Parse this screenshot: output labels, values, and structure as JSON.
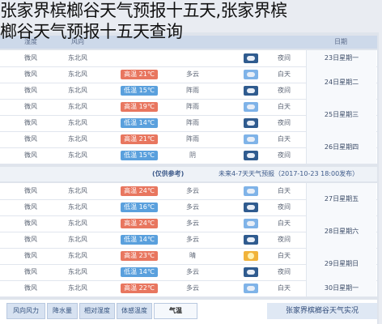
{
  "page_title": {
    "line1": "张家界槟榔谷天气预报十五天,张家界槟",
    "line2": "榔谷天气预报十五天查询"
  },
  "header": {
    "humidity": "湿度",
    "wind": "风向",
    "date": "日期"
  },
  "blocks": [
    {
      "rows": [
        {
          "hum": "微风",
          "dir": "东北风",
          "temp": "",
          "temp_type": "none",
          "weather": "",
          "icon": "night",
          "dn": "夜间",
          "date": "23日星期一",
          "date_span": 1
        },
        {
          "hum": "微风",
          "dir": "东北风",
          "temp": "高温 21℃",
          "temp_type": "hot",
          "weather": "多云",
          "icon": "day",
          "dn": "白天",
          "date": "24日星期二",
          "date_span": 2
        },
        {
          "hum": "微风",
          "dir": "东北风",
          "temp": "低温 15℃",
          "temp_type": "cool",
          "weather": "阵雨",
          "icon": "night",
          "dn": "夜间",
          "date": "",
          "date_span": 0
        },
        {
          "hum": "微风",
          "dir": "东北风",
          "temp": "高温 19℃",
          "temp_type": "hot",
          "weather": "阵雨",
          "icon": "day",
          "dn": "白天",
          "date": "25日星期三",
          "date_span": 2
        },
        {
          "hum": "微风",
          "dir": "东北风",
          "temp": "低温 14℃",
          "temp_type": "cool",
          "weather": "阵雨",
          "icon": "night",
          "dn": "夜间",
          "date": "",
          "date_span": 0
        },
        {
          "hum": "微风",
          "dir": "东北风",
          "temp": "高温 21℃",
          "temp_type": "hot",
          "weather": "阵雨",
          "icon": "day",
          "dn": "白天",
          "date": "26日星期四",
          "date_span": 2
        },
        {
          "hum": "微风",
          "dir": "东北风",
          "temp": "低温 15℃",
          "temp_type": "cool",
          "weather": "阴",
          "icon": "night",
          "dn": "夜间",
          "date": "",
          "date_span": 0
        }
      ]
    },
    {
      "rows": [
        {
          "hum": "微风",
          "dir": "东北风",
          "temp": "高温 24℃",
          "temp_type": "hot",
          "weather": "多云",
          "icon": "day",
          "dn": "白天",
          "date": "27日星期五",
          "date_span": 2
        },
        {
          "hum": "微风",
          "dir": "东北风",
          "temp": "低温 16℃",
          "temp_type": "cool",
          "weather": "多云",
          "icon": "night",
          "dn": "夜间",
          "date": "",
          "date_span": 0
        },
        {
          "hum": "微风",
          "dir": "东北风",
          "temp": "高温 24℃",
          "temp_type": "hot",
          "weather": "多云",
          "icon": "day",
          "dn": "白天",
          "date": "28日星期六",
          "date_span": 2
        },
        {
          "hum": "微风",
          "dir": "东北风",
          "temp": "低温 14℃",
          "temp_type": "cool",
          "weather": "多云",
          "icon": "night",
          "dn": "夜间",
          "date": "",
          "date_span": 0
        },
        {
          "hum": "微风",
          "dir": "东北风",
          "temp": "高温 23℃",
          "temp_type": "hot",
          "weather": "晴",
          "icon": "sun",
          "dn": "白天",
          "date": "29日星期日",
          "date_span": 2
        },
        {
          "hum": "微风",
          "dir": "东北风",
          "temp": "低温 14℃",
          "temp_type": "cool",
          "weather": "多云",
          "icon": "night",
          "dn": "夜间",
          "date": "",
          "date_span": 0
        },
        {
          "hum": "微风",
          "dir": "东北风",
          "temp": "高温 22℃",
          "temp_type": "hot",
          "weather": "多云",
          "icon": "day",
          "dn": "白天",
          "date": "30日星期一",
          "date_span": 1
        }
      ]
    }
  ],
  "notice": {
    "left": "(仅供参考)",
    "right": "未来4-7天天气预报（2017-10-23 18:00发布）"
  },
  "bottom_tabs": [
    "风向风力",
    "降水量",
    "相对湿度",
    "体感温度",
    "气温"
  ],
  "bottom_title": "张家界槟榔谷天气实况",
  "colors": {
    "hot": "#e8765f",
    "cool": "#5aa0dd",
    "header": "#cdd9ea"
  }
}
